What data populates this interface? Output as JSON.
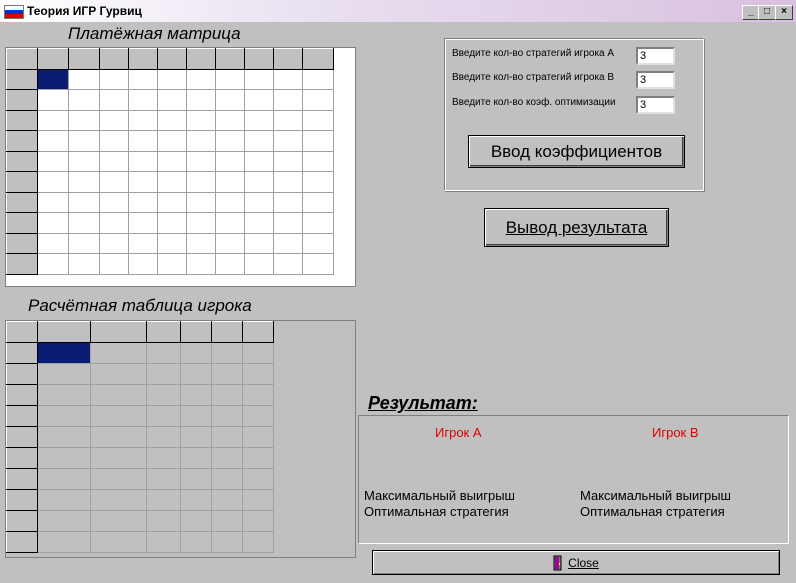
{
  "window": {
    "title": "Теория ИГР Гурвиц",
    "minimize": "_",
    "maximize": "□",
    "close": "×"
  },
  "matrix": {
    "caption": "Платёжная матрица",
    "cols": 11,
    "rows": 11
  },
  "player_table": {
    "caption": "Расчётная таблица игрока",
    "cols": 7,
    "rows": 11
  },
  "inputs": {
    "strategies_a_label": "Введите кол-во стратегий игрока A",
    "strategies_a_value": "3",
    "strategies_b_label": "Введите кол-во стратегий игрока B",
    "strategies_b_value": "3",
    "coef_label": "Введите кол-во коэф. оптимизации",
    "coef_value": "3"
  },
  "buttons": {
    "enter_coefficients": "Ввод коэффициентов",
    "output_result": "Вывод результата",
    "close": "Close"
  },
  "result": {
    "title": "Результат:",
    "player_a": "Игрок A",
    "player_b": "Игрок B",
    "max_win_a": "Максимальный выигрыш",
    "opt_strategy_a": "Оптимальная стратегия",
    "max_win_b": "Максимальный выигрыш",
    "opt_strategy_b": "Оптимальная стратегия"
  },
  "colors": {
    "selected_cell": "#0a1c74",
    "player_label": "#e00000",
    "face": "#c0c0c0"
  }
}
